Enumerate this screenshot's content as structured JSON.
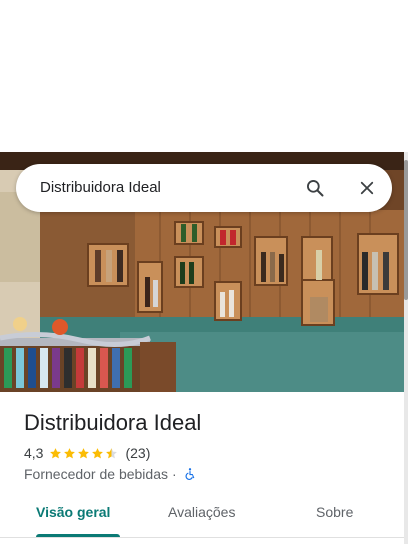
{
  "search": {
    "query": "Distribuidora Ideal",
    "search_icon": "search-icon",
    "close_icon": "close-icon"
  },
  "hero": {
    "icon": "storefront-photo"
  },
  "place": {
    "name": "Distribuidora Ideal",
    "rating": "4,3",
    "rating_numeric": 4.3,
    "review_count": "(23)",
    "category": "Fornecedor de bebidas",
    "separator": "·",
    "accessibility_icon": "wheelchair-accessible-icon"
  },
  "tabs": [
    {
      "label": "Visão geral",
      "active": true
    },
    {
      "label": "Avaliações",
      "active": false
    },
    {
      "label": "Sobre",
      "active": false
    }
  ],
  "colors": {
    "accent": "#0b7a75",
    "star": "#fbbc04",
    "access_blue": "#1a73e8",
    "text_primary": "#202124",
    "text_secondary": "#5f6368"
  }
}
